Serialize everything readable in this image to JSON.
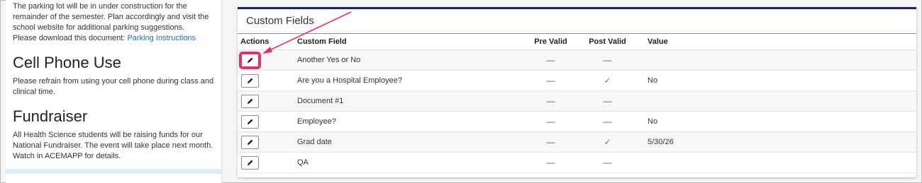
{
  "left": {
    "intro_line": "The parking lot will be in under construction for the remainder of the semester. Plan accordingly and visit the school website for additional parking suggestions.",
    "download_prefix": "Please download this document:",
    "download_link": "Parking Instructions",
    "cell_heading": "Cell Phone Use",
    "cell_text": "Please refrain from using your cell phone during class and clinical time.",
    "fund_heading": "Fundraiser",
    "fund_text": "All Health Science students will be raising funds for our National Fundraiser. The event will take place next month. Watch in ACEMAPP for details."
  },
  "card": {
    "title": "Custom Fields",
    "headers": {
      "actions": "Actions",
      "field": "Custom Field",
      "pre": "Pre Valid",
      "post": "Post Valid",
      "value": "Value"
    },
    "rows": [
      {
        "field": "Another Yes or No",
        "pre": "—",
        "post": "—",
        "value": ""
      },
      {
        "field": "Are you a Hospital Employee?",
        "pre": "—",
        "post": "✓",
        "value": "No"
      },
      {
        "field": "Document #1",
        "pre": "—",
        "post": "—",
        "value": ""
      },
      {
        "field": "Employee?",
        "pre": "—",
        "post": "—",
        "value": "No"
      },
      {
        "field": "Grad date",
        "pre": "—",
        "post": "✓",
        "value": "5/30/26"
      },
      {
        "field": "QA",
        "pre": "—",
        "post": "—",
        "value": ""
      }
    ],
    "edit_icon": "pencil-icon"
  },
  "colors": {
    "accent_border": "#1f2a5c",
    "highlight": "#e0336b",
    "link": "#1f6fb2"
  }
}
